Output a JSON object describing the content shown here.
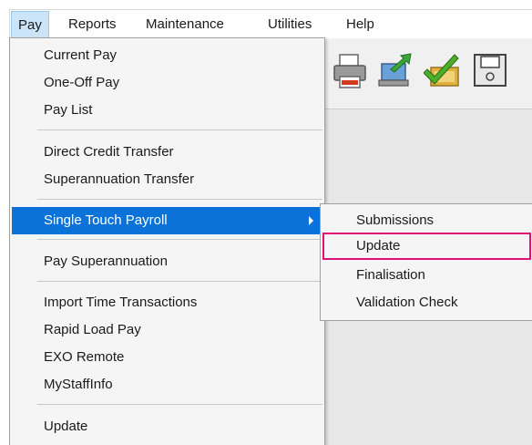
{
  "menubar": {
    "items": [
      {
        "label": "Pay"
      },
      {
        "label": "Reports"
      },
      {
        "label": "Maintenance"
      },
      {
        "label": "Utilities"
      },
      {
        "label": "Help"
      }
    ]
  },
  "toolbar": {
    "icons": [
      "printer-icon",
      "export-icon",
      "approve-icon",
      "save-icon"
    ]
  },
  "pay_menu": {
    "items": [
      {
        "label": "Current Pay"
      },
      {
        "label": "One-Off Pay"
      },
      {
        "label": "Pay List"
      },
      {
        "label": "Direct Credit Transfer"
      },
      {
        "label": "Superannuation Transfer"
      },
      {
        "label": "Single Touch Payroll"
      },
      {
        "label": "Pay Superannuation"
      },
      {
        "label": "Import Time Transactions"
      },
      {
        "label": "Rapid Load Pay"
      },
      {
        "label": "EXO Remote"
      },
      {
        "label": "MyStaffInfo"
      },
      {
        "label": "Update"
      }
    ]
  },
  "stp_submenu": {
    "items": [
      {
        "label": "Submissions"
      },
      {
        "label": "Update"
      },
      {
        "label": "Finalisation"
      },
      {
        "label": "Validation Check"
      }
    ]
  },
  "colors": {
    "highlight": "#0a72d8",
    "focus_outline": "#e0127a",
    "menu_bg": "#f5f5f5"
  }
}
